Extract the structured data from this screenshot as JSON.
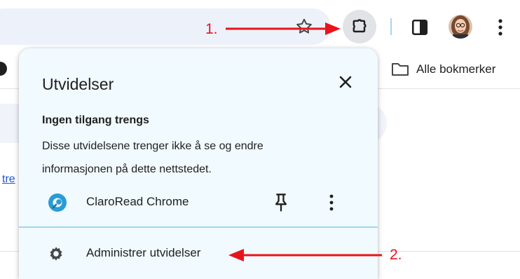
{
  "toolbar": {
    "annotation_1": "1.",
    "star_icon": "star-outline-icon",
    "extensions_icon": "puzzle-icon",
    "side_panel_icon": "side-panel-icon",
    "menu_icon": "vertical-dots-icon"
  },
  "bookmarks_bar": {
    "all_bookmarks_label": "Alle bokmerker"
  },
  "page": {
    "link_fragment": "tre"
  },
  "popup": {
    "title": "Utvidelser",
    "section_heading": "Ingen tilgang trengs",
    "section_description": "Disse utvidelsene trenger ikke å se og endre informasjonen på dette nettstedet.",
    "extensions": [
      {
        "name": "ClaroRead Chrome"
      }
    ],
    "manage_label": "Administrer utvidelser",
    "annotation_2": "2."
  },
  "colors": {
    "annotation_red": "#e8141b",
    "popup_bg": "#f1fafe",
    "claro_blue": "#2a9bd3",
    "divider": "#9ed8f3"
  }
}
